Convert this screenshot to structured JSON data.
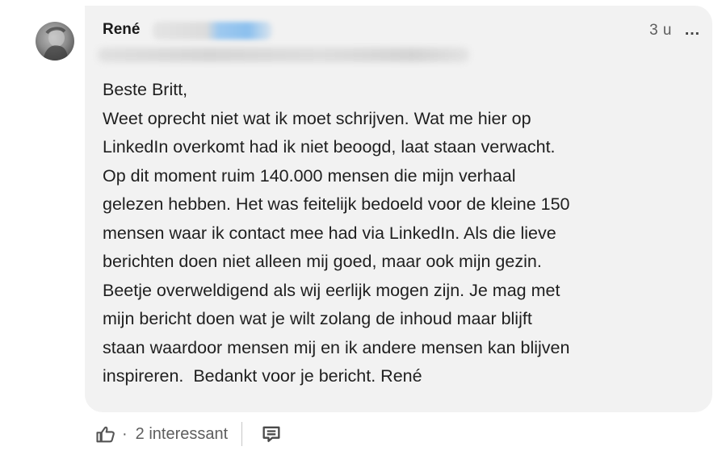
{
  "comment": {
    "author_name": "René",
    "timestamp": "3 u",
    "more_icon": "…",
    "body_lines": [
      "Beste Britt,",
      "Weet oprecht niet wat ik moet schrijven. Wat me hier op",
      "LinkedIn overkomt had ik niet beoogd, laat staan verwacht.",
      "Op dit moment ruim 140.000 mensen die mijn verhaal",
      "gelezen hebben. Het was feitelijk bedoeld voor de kleine 150",
      "mensen waar ik contact mee had via LinkedIn. Als die lieve",
      "berichten doen niet alleen mij goed, maar ook mijn gezin.",
      "Beetje overweldigend als wij eerlijk mogen zijn. Je mag met",
      "mijn bericht doen wat je wilt zolang de inhoud maar blijft",
      "staan waardoor mensen mij en ik andere mensen kan blijven",
      "inspireren.  Bedankt voor je bericht. René"
    ]
  },
  "actions": {
    "like_icon": "thumbs-up-icon",
    "separator": "·",
    "reactions_label": "2 interessant",
    "reply_icon": "comment-icon"
  },
  "colors": {
    "bubble_bg": "#f2f2f2",
    "text": "#1f1f1f",
    "muted": "#5e5e5e"
  }
}
